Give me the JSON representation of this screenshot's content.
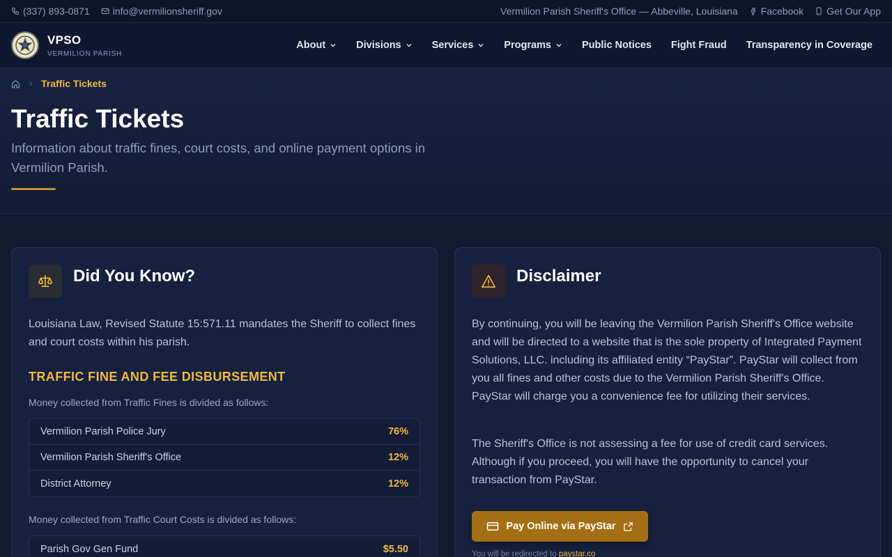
{
  "topbar": {
    "phone": "(337) 893-0871",
    "email": "info@vermilionsheriff.gov",
    "office": "Vermilion Parish Sheriff's Office — Abbeville, Louisiana",
    "facebook": "Facebook",
    "app": "Get Our App"
  },
  "brand": {
    "name": "VPSO",
    "sub": "VERMILION PARISH"
  },
  "nav": {
    "items": [
      {
        "label": "About"
      },
      {
        "label": "Divisions"
      },
      {
        "label": "Services"
      },
      {
        "label": "Programs"
      },
      {
        "label": "Public Notices"
      },
      {
        "label": "Fight Fraud"
      },
      {
        "label": "Transparency in Coverage"
      }
    ]
  },
  "breadcrumb": {
    "current": "Traffic Tickets"
  },
  "hero": {
    "title": "Traffic Tickets",
    "lede": "Information about traffic fines, court costs, and online payment options in Vermilion Parish."
  },
  "did_you_know": {
    "title": "Did You Know?",
    "intro": "Louisiana Law, Revised Statute 15:571.11 mandates the Sheriff to collect fines and court costs within his parish.",
    "section_title": "TRAFFIC FINE AND FEE DISBURSEMENT",
    "fines_caption": "Money collected from Traffic Fines is divided as follows:",
    "fines": [
      {
        "name": "Vermilion Parish Police Jury",
        "value": "76%"
      },
      {
        "name": "Vermilion Parish Sheriff's Office",
        "value": "12%"
      },
      {
        "name": "District Attorney",
        "value": "12%"
      }
    ],
    "court_caption": "Money collected from Traffic Court Costs is divided as follows:",
    "court": [
      {
        "name": "Parish Gov Gen Fund",
        "value": "$5.50"
      }
    ]
  },
  "disclaimer": {
    "title": "Disclaimer",
    "p1": "By continuing, you will be leaving the Vermilion Parish Sheriff's Office website and will be directed to a website that is the sole property of Integrated Payment Solutions, LLC. including its affiliated entity “PayStar”. PayStar will collect from you all fines and other costs due to the Vermilion Parish Sheriff's Office. PayStar will charge you a convenience fee for utilizing their services.",
    "p2": "The Sheriff's Office is not assessing a fee for use of credit card services. Although if you proceed, you will have the opportunity to cancel your transaction from PayStar.",
    "button": "Pay Online via PayStar",
    "redirect_prefix": "You will be redirected to",
    "redirect_link": "paystar.co"
  },
  "colors": {
    "accent": "#f0b93a",
    "button": "#a36f14",
    "background": "#111a2f",
    "card": "#16213f"
  }
}
